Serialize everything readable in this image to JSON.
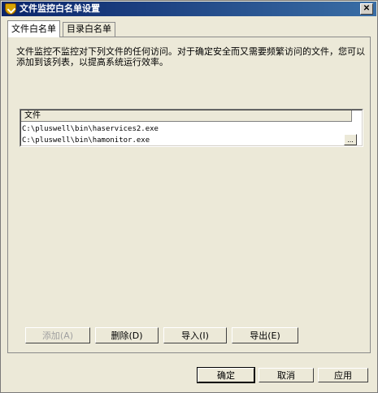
{
  "window": {
    "title": "文件监控白名单设置",
    "close_symbol": "✕"
  },
  "tabs": [
    {
      "label": "文件白名单",
      "active": true
    },
    {
      "label": "目录白名单",
      "active": false
    }
  ],
  "description": "文件监控不监控对下列文件的任何访问。对于确定安全而又需要频繁访问的文件，您可以添加到该列表，以提高系统运行效率。",
  "file_list": {
    "header": "文件",
    "rows": [
      "C:\\pluswell\\bin\\haservices2.exe",
      "C:\\pluswell\\bin\\hamonitor.exe"
    ],
    "browse_label": "..."
  },
  "list_buttons": {
    "add": "添加(A)",
    "delete": "删除(D)",
    "import": "导入(I)",
    "export": "导出(E)"
  },
  "dialog_buttons": {
    "ok": "确定",
    "cancel": "取消",
    "apply": "应用"
  },
  "colors": {
    "title_bar": "#0a246a",
    "dialog_face": "#ece9d8"
  }
}
